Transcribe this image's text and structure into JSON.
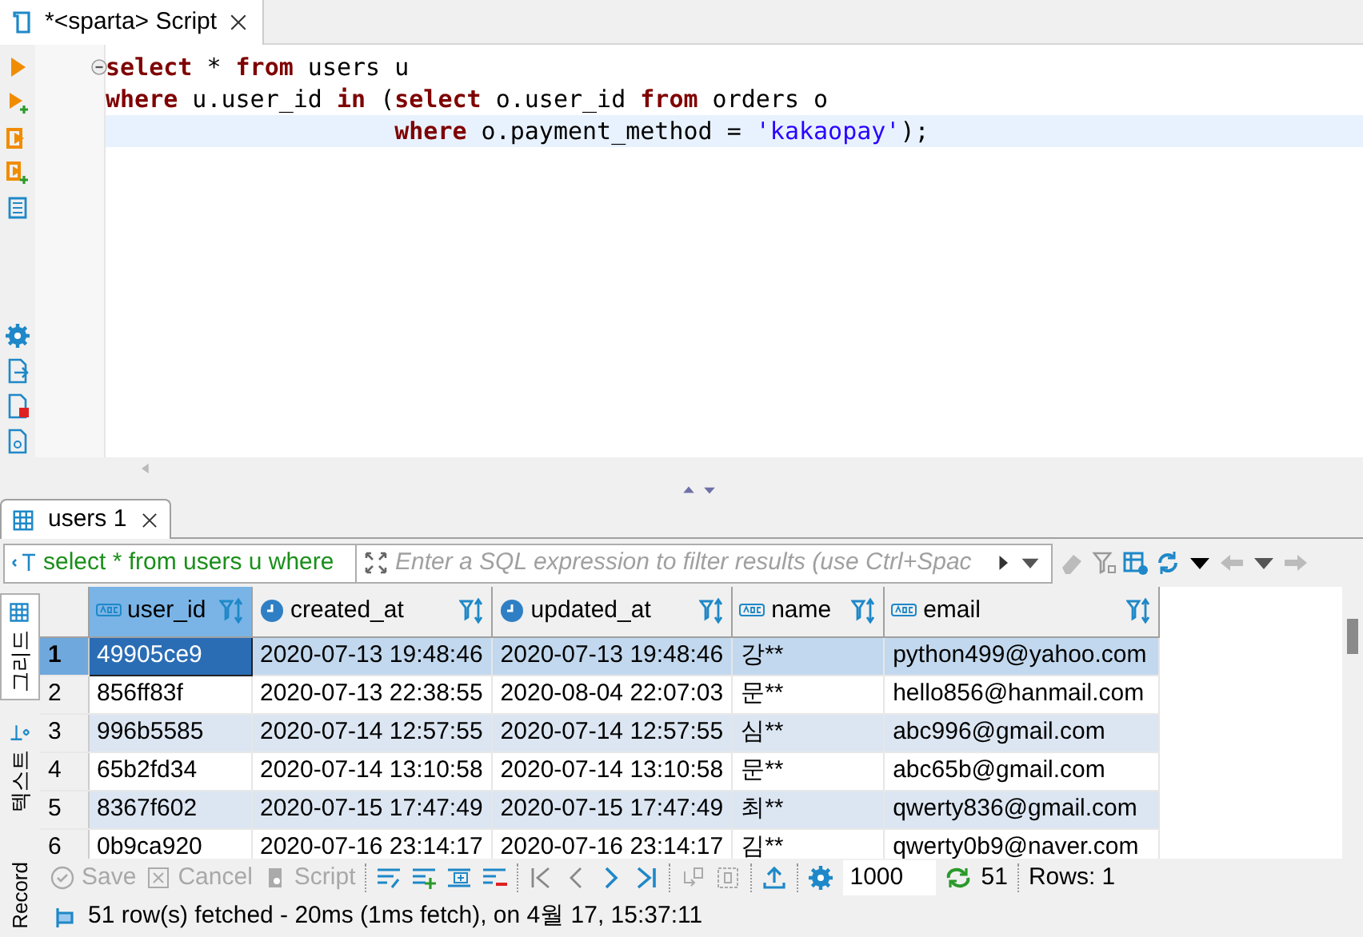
{
  "editor_tab": {
    "title": "*<sparta> Script",
    "selected": true
  },
  "code_lines": [
    {
      "current": false,
      "tokens": [
        {
          "kind": "keyword",
          "text": "select"
        },
        {
          "kind": "plain",
          "text": " * "
        },
        {
          "kind": "keyword",
          "text": "from"
        },
        {
          "kind": "plain",
          "text": " users u"
        }
      ]
    },
    {
      "current": false,
      "tokens": [
        {
          "kind": "keyword",
          "text": "where"
        },
        {
          "kind": "plain",
          "text": " u.user_id "
        },
        {
          "kind": "keyword",
          "text": "in"
        },
        {
          "kind": "plain",
          "text": " ("
        },
        {
          "kind": "keyword",
          "text": "select"
        },
        {
          "kind": "plain",
          "text": " o.user_id "
        },
        {
          "kind": "keyword",
          "text": "from"
        },
        {
          "kind": "plain",
          "text": " orders o"
        }
      ]
    },
    {
      "current": true,
      "tokens": [
        {
          "kind": "keyword",
          "text": "                    where"
        },
        {
          "kind": "plain",
          "text": " o.payment_method = "
        },
        {
          "kind": "string",
          "text": "'kakaopay'"
        },
        {
          "kind": "plain",
          "text": ");"
        }
      ]
    }
  ],
  "results_tab": {
    "title": "users 1",
    "selected": true
  },
  "filter": {
    "query": "select * from users u where",
    "placeholder": "Enter a SQL expression to filter results (use Ctrl+Spac"
  },
  "view_tabs": [
    {
      "label": "그리드",
      "selected": true
    },
    {
      "label": "텍스트",
      "selected": false
    },
    {
      "label": "Record",
      "selected": false
    }
  ],
  "table": {
    "columns": [
      {
        "label": "user_id",
        "kind": "text"
      },
      {
        "label": "created_at",
        "kind": "datetime"
      },
      {
        "label": "updated_at",
        "kind": "datetime"
      },
      {
        "label": "name",
        "kind": "text"
      },
      {
        "label": "email",
        "kind": "text"
      }
    ],
    "rows": [
      {
        "number": "1",
        "selected": true,
        "cells": [
          "49905ce9",
          "2020-07-13 19:48:46",
          "2020-07-13 19:48:46",
          "강**",
          "python499@yahoo.com"
        ]
      },
      {
        "number": "2",
        "selected": false,
        "cells": [
          "856ff83f",
          "2020-07-13 22:38:55",
          "2020-08-04 22:07:03",
          "문**",
          "hello856@hanmail.com"
        ]
      },
      {
        "number": "3",
        "selected": false,
        "cells": [
          "996b5585",
          "2020-07-14 12:57:55",
          "2020-07-14 12:57:55",
          "심**",
          "abc996@gmail.com"
        ]
      },
      {
        "number": "4",
        "selected": false,
        "cells": [
          "65b2fd34",
          "2020-07-14 13:10:58",
          "2020-07-14 13:10:58",
          "문**",
          "abc65b@gmail.com"
        ]
      },
      {
        "number": "5",
        "selected": false,
        "cells": [
          "8367f602",
          "2020-07-15 17:47:49",
          "2020-07-15 17:47:49",
          "최**",
          "qwerty836@gmail.com"
        ]
      },
      {
        "number": "6",
        "selected": false,
        "cells": [
          "0b9ca920",
          "2020-07-16 23:14:17",
          "2020-07-16 23:14:17",
          "김**",
          "qwerty0b9@naver.com"
        ]
      }
    ]
  },
  "bottom_toolbar": {
    "buttons": [
      {
        "label": "Save",
        "disabled": true
      },
      {
        "label": "Cancel",
        "disabled": true
      },
      {
        "label": "Script",
        "disabled": true
      }
    ],
    "fetch_size": "1000",
    "count": "51",
    "rows_label": "Rows: 1"
  },
  "status": "51 row(s) fetched - 20ms (1ms fetch), on 4월 17, 15:37:11"
}
